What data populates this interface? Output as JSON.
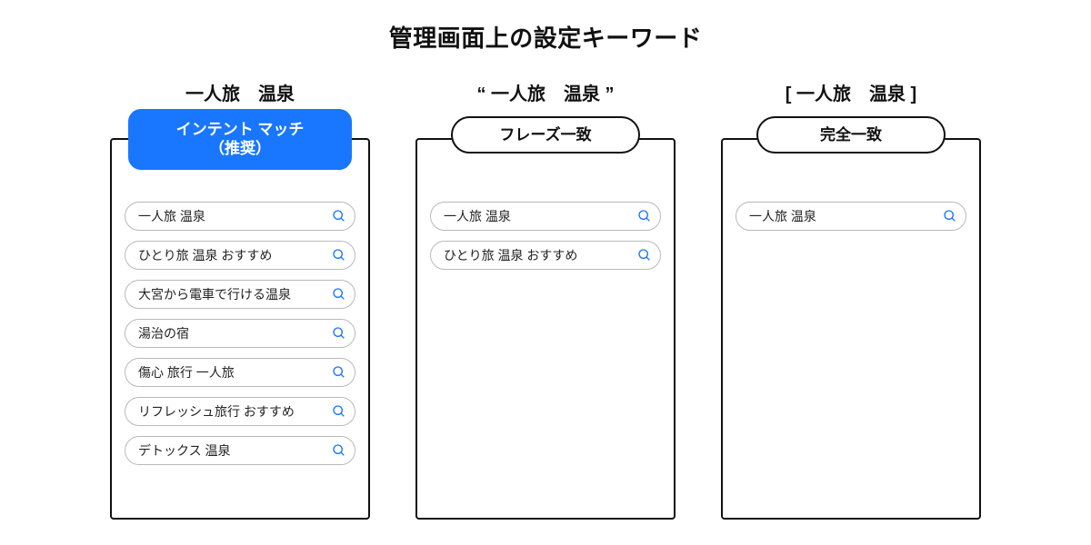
{
  "title": "管理画面上の設定キーワード",
  "colors": {
    "primary": "#1976ff",
    "border": "#111111",
    "queryBorder": "#b9b9b9"
  },
  "columns": [
    {
      "keyword": "一人旅　温泉",
      "tabLabel": "インテント マッチ\n（推奨）",
      "tabPrimary": true,
      "queries": [
        "一人旅 温泉",
        "ひとり旅 温泉 おすすめ",
        "大宮から電車で行ける温泉",
        "湯治の宿",
        "傷心 旅行 一人旅",
        "リフレッシュ旅行 おすすめ",
        "デトックス 温泉"
      ]
    },
    {
      "keyword": "“ 一人旅　温泉 ”",
      "tabLabel": "フレーズ一致",
      "tabPrimary": false,
      "queries": [
        "一人旅 温泉",
        "ひとり旅 温泉 おすすめ"
      ]
    },
    {
      "keyword": "[ 一人旅　温泉 ]",
      "tabLabel": "完全一致",
      "tabPrimary": false,
      "queries": [
        "一人旅 温泉"
      ]
    }
  ]
}
